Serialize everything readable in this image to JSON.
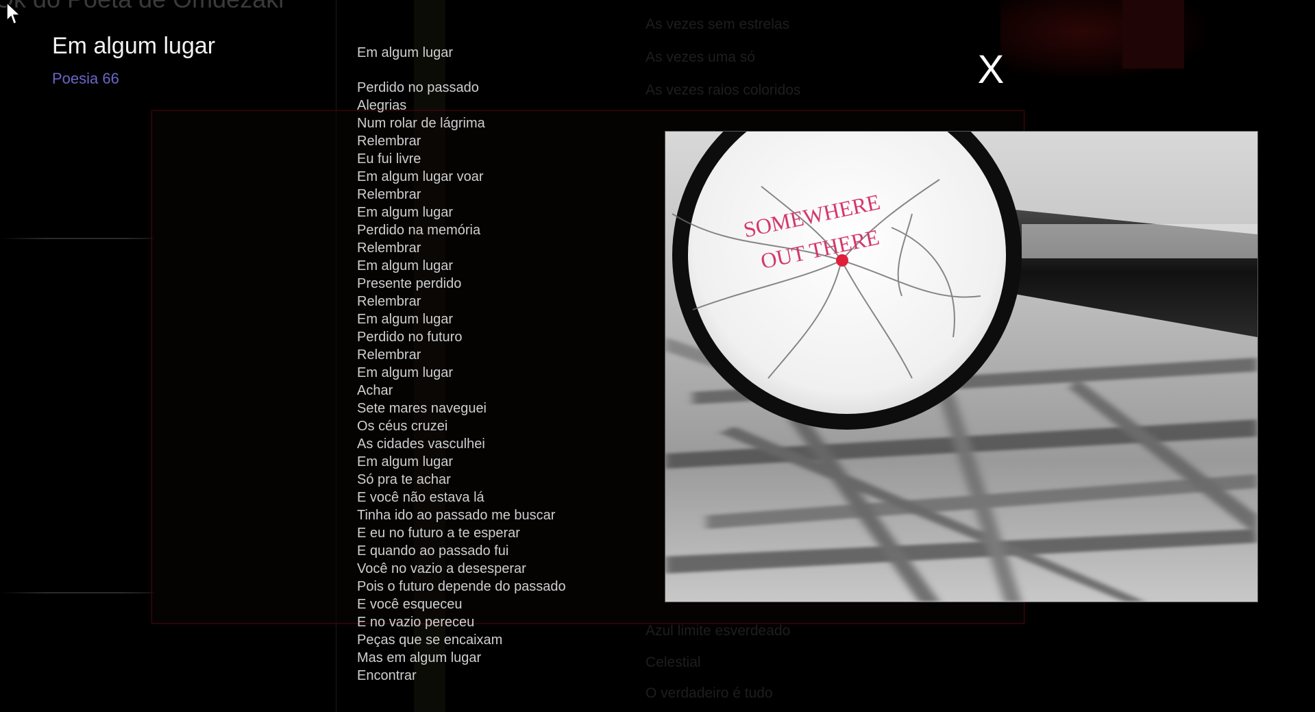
{
  "background": {
    "site_title": "Ok do Poeta de Omdezaki",
    "top_lines": [
      "As vezes sem estrelas",
      "As vezes uma só",
      "As vezes raios coloridos"
    ],
    "bottom_lines": [
      "Azul limite esverdeado",
      "Celestial",
      "O verdadeiro é tudo"
    ]
  },
  "poem": {
    "title": "Em algum lugar",
    "subtitle": "Poesia 66",
    "first_line": "Em algum lugar",
    "lines": [
      "Perdido no passado",
      "Alegrias",
      "Num rolar de lágrima",
      "Relembrar",
      "Eu fui livre",
      "Em algum lugar voar",
      "Relembrar",
      "Em algum lugar",
      "Perdido na memória",
      "Relembrar",
      "Em algum lugar",
      "Presente perdido",
      "Relembrar",
      "Em algum lugar",
      "Perdido no futuro",
      "Relembrar",
      "Em algum lugar",
      "Achar",
      "Sete mares naveguei",
      "Os céus cruzei",
      "As cidades vasculhei",
      "Em algum lugar",
      "Só pra te achar",
      "E você não estava lá",
      "Tinha ido ao passado me buscar",
      "E eu no futuro a te esperar",
      "E quando ao passado fui",
      "Você no vazio a desesperar",
      "Pois o futuro depende do passado",
      "E você esqueceu",
      "E no vazio pereceu",
      "Peças que se encaixam",
      "Mas em algum lugar",
      "Encontrar"
    ]
  },
  "close_label": "X",
  "image": {
    "lens_text_line1": "SOMEWHERE",
    "lens_text_line2": "OUT  THERE",
    "lens_text_color": "#d4386a",
    "marker_color": "#e0203a"
  },
  "colors": {
    "subtitle": "#6a66c8",
    "panel_border": "#3e0a0e"
  }
}
